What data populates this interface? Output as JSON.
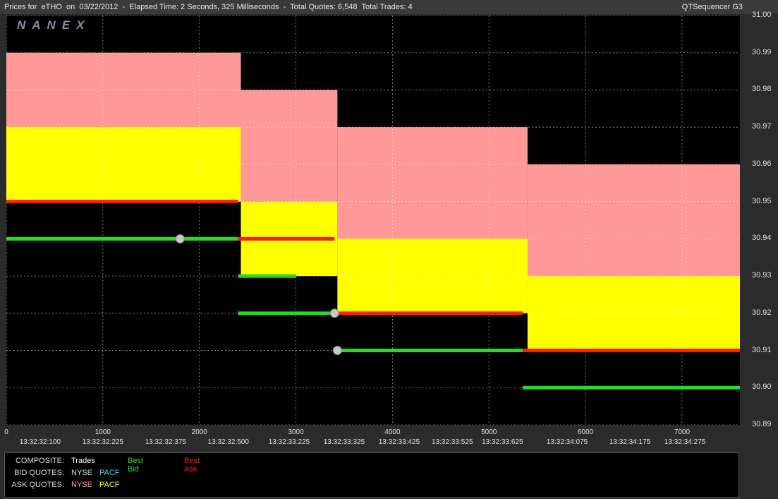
{
  "header": {
    "title": "Prices for  eTHO  on  03/22/2012  -  Elapsed Time: 2 Seconds, 325 Milliseconds  -  Total Quotes: 6,548  Total Trades: 4",
    "app_name": "QTSequencer G3",
    "logo": "NANEX"
  },
  "colors": {
    "background": "#000000",
    "best_bid": "#22dd22",
    "best_ask": "#ff1a1a",
    "nyse_bid": "#b8f0b8",
    "pacf_bid": "#40d8e8",
    "nyse_ask": "#ff9999",
    "pacf_ask": "#ffff00",
    "trade": "#c8c8c8",
    "grid": "#ffffff"
  },
  "chart_data": {
    "type": "line",
    "title": "",
    "xlabel": "",
    "ylabel": "",
    "xlim": [
      0,
      7600
    ],
    "ylim": [
      30.89,
      31.0
    ],
    "grid": true,
    "x_ticks": [
      "0",
      "1000",
      "2000",
      "3000",
      "4000",
      "5000",
      "6000",
      "7000"
    ],
    "time_labels": [
      {
        "x": 350,
        "label": "13:32:32:100"
      },
      {
        "x": 1000,
        "label": "13:32:32:225"
      },
      {
        "x": 1650,
        "label": "13:32:32:375"
      },
      {
        "x": 2300,
        "label": "13:32:32:500"
      },
      {
        "x": 2930,
        "label": "13:32:33:225"
      },
      {
        "x": 3500,
        "label": "13:32:33:325"
      },
      {
        "x": 4070,
        "label": "13:32:33:425"
      },
      {
        "x": 4620,
        "label": "13:32:33:525"
      },
      {
        "x": 5140,
        "label": "13:32:33:625"
      },
      {
        "x": 5810,
        "label": "13:32:34:075"
      },
      {
        "x": 6460,
        "label": "13:32:34:175"
      },
      {
        "x": 7030,
        "label": "13:32:34:275"
      }
    ],
    "y_ticks": [
      "31.00",
      "30.99",
      "30.98",
      "30.97",
      "30.96",
      "30.95",
      "30.94",
      "30.93",
      "30.92",
      "30.91",
      "30.90",
      "30.89"
    ],
    "series": [
      {
        "name": "Best Bid",
        "color": "#22dd22",
        "points": [
          [
            0,
            30.94
          ],
          [
            2400,
            30.94
          ],
          [
            2400,
            30.93
          ],
          [
            2850,
            30.93
          ],
          [
            3000,
            30.93
          ],
          [
            2400,
            30.92
          ],
          [
            3400,
            30.92
          ],
          [
            3400,
            30.91
          ],
          [
            5350,
            30.91
          ],
          [
            5350,
            30.9
          ],
          [
            7600,
            30.9
          ]
        ]
      },
      {
        "name": "Best Ask",
        "color": "#ff1a1a",
        "points": [
          [
            0,
            30.95
          ],
          [
            2400,
            30.95
          ],
          [
            2400,
            30.94
          ],
          [
            3400,
            30.94
          ],
          [
            3400,
            30.92
          ],
          [
            5350,
            30.92
          ],
          [
            5350,
            30.91
          ],
          [
            7600,
            30.91
          ]
        ]
      }
    ],
    "nyse_ask_regions": [
      {
        "x": [
          0,
          2430
        ],
        "y": [
          30.95,
          30.99
        ]
      },
      {
        "x": [
          2430,
          3430
        ],
        "y": [
          30.95,
          30.98
        ]
      },
      {
        "x": [
          3430,
          5400
        ],
        "y": [
          30.93,
          30.97
        ]
      },
      {
        "x": [
          5400,
          7600
        ],
        "y": [
          30.91,
          30.96
        ]
      }
    ],
    "pacf_ask_regions": [
      {
        "x": [
          0,
          2430
        ],
        "y": [
          30.95,
          30.97
        ]
      },
      {
        "x": [
          2430,
          3430
        ],
        "y": [
          30.93,
          30.95
        ]
      },
      {
        "x": [
          3430,
          5400
        ],
        "y": [
          30.92,
          30.94
        ]
      },
      {
        "x": [
          5400,
          7600
        ],
        "y": [
          30.91,
          30.93
        ]
      }
    ],
    "trades": [
      [
        1800,
        30.94
      ],
      [
        3400,
        30.92
      ],
      [
        3430,
        30.91
      ]
    ]
  },
  "legend": {
    "rows": [
      {
        "label": "COMPOSITE:",
        "a": "Trades",
        "b": "Best Bid",
        "c": "Best Ask"
      },
      {
        "label": "BID QUOTES:",
        "a": "NYSE",
        "b": "PACF"
      },
      {
        "label": "ASK QUOTES:",
        "a": "NYSE",
        "b": "PACF"
      }
    ]
  }
}
